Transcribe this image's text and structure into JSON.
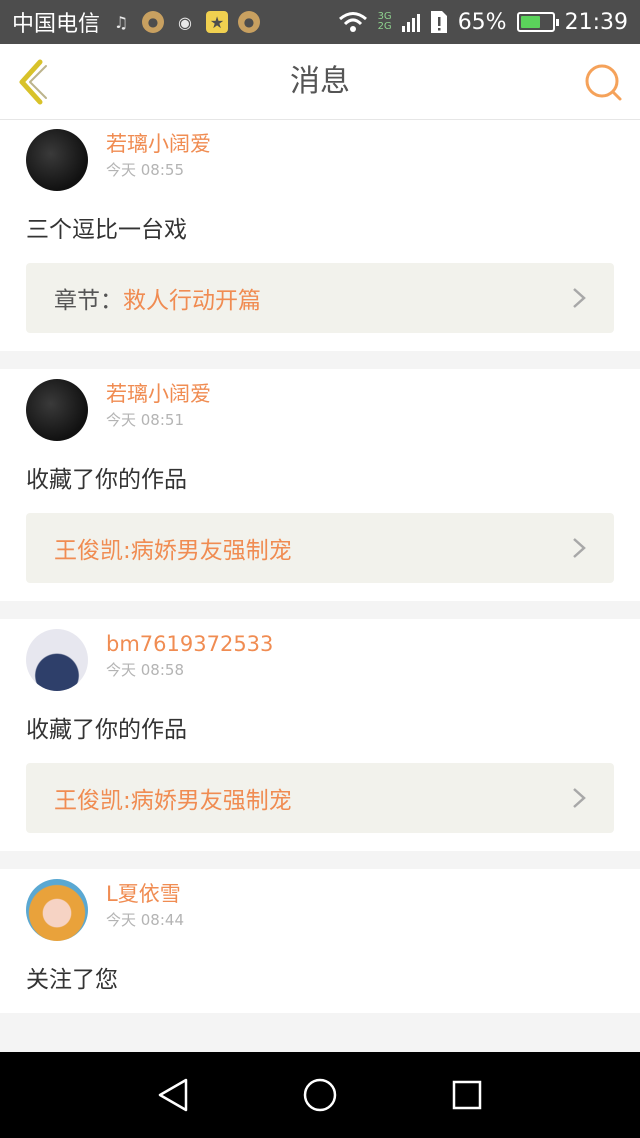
{
  "status_bar": {
    "carrier": "中国电信",
    "network_top": "3G",
    "network_bottom": "2G",
    "battery_percent": "65%",
    "battery_level": 0.65,
    "time": "21:39",
    "notification_icons": [
      "music-icon",
      "chat-icon",
      "app-icon",
      "star-icon",
      "coin-icon"
    ]
  },
  "header": {
    "title": "消息",
    "back_icon": "chevron-left-icon",
    "search_icon": "search-icon"
  },
  "colors": {
    "accent": "#f08c52",
    "back_arrow": "#d8c22a",
    "ref_background": "#f2f2ec",
    "status_bar": "#4d4d4d"
  },
  "messages": [
    {
      "username": "若璃小阔爱",
      "time": "今天 08:55",
      "text": "三个逗比一台戏",
      "ref_label": "章节：",
      "ref_value": "救人行动开篇"
    },
    {
      "username": "若璃小阔爱",
      "time": "今天 08:51",
      "text": "收藏了你的作品",
      "ref_label": "",
      "ref_value": "王俊凯:病娇男友强制宠"
    },
    {
      "username": "bm7619372533",
      "time": "今天 08:58",
      "text": "收藏了你的作品",
      "ref_label": "",
      "ref_value": "王俊凯:病娇男友强制宠"
    },
    {
      "username": "L夏依雪",
      "time": "今天 08:44",
      "text": "关注了您"
    }
  ]
}
